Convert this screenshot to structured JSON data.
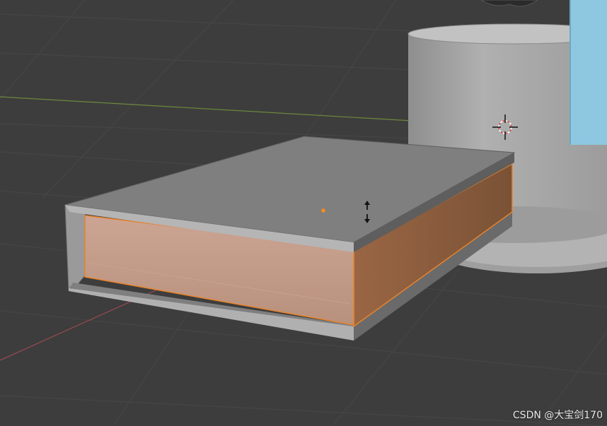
{
  "viewport": {
    "objects": [
      "book-box",
      "cylinder",
      "cylinder-base",
      "light-blue-panel"
    ],
    "cursor": "vertical-resize-arrows",
    "pivot": "3d-cursor"
  },
  "colors": {
    "background": "#3d3d3d",
    "grid_line": "#474747",
    "x_axis": "#9c4a52",
    "y_axis": "#6b8a3c",
    "selection_face": "#c6a08c",
    "selection_side": "#8f5f3f",
    "selection_outline": "#e8832a",
    "cover_top": "#808080",
    "cylinder": "#a6a6a6",
    "panel": "#8ec7e0"
  },
  "watermark": "CSDN @大宝剑170"
}
